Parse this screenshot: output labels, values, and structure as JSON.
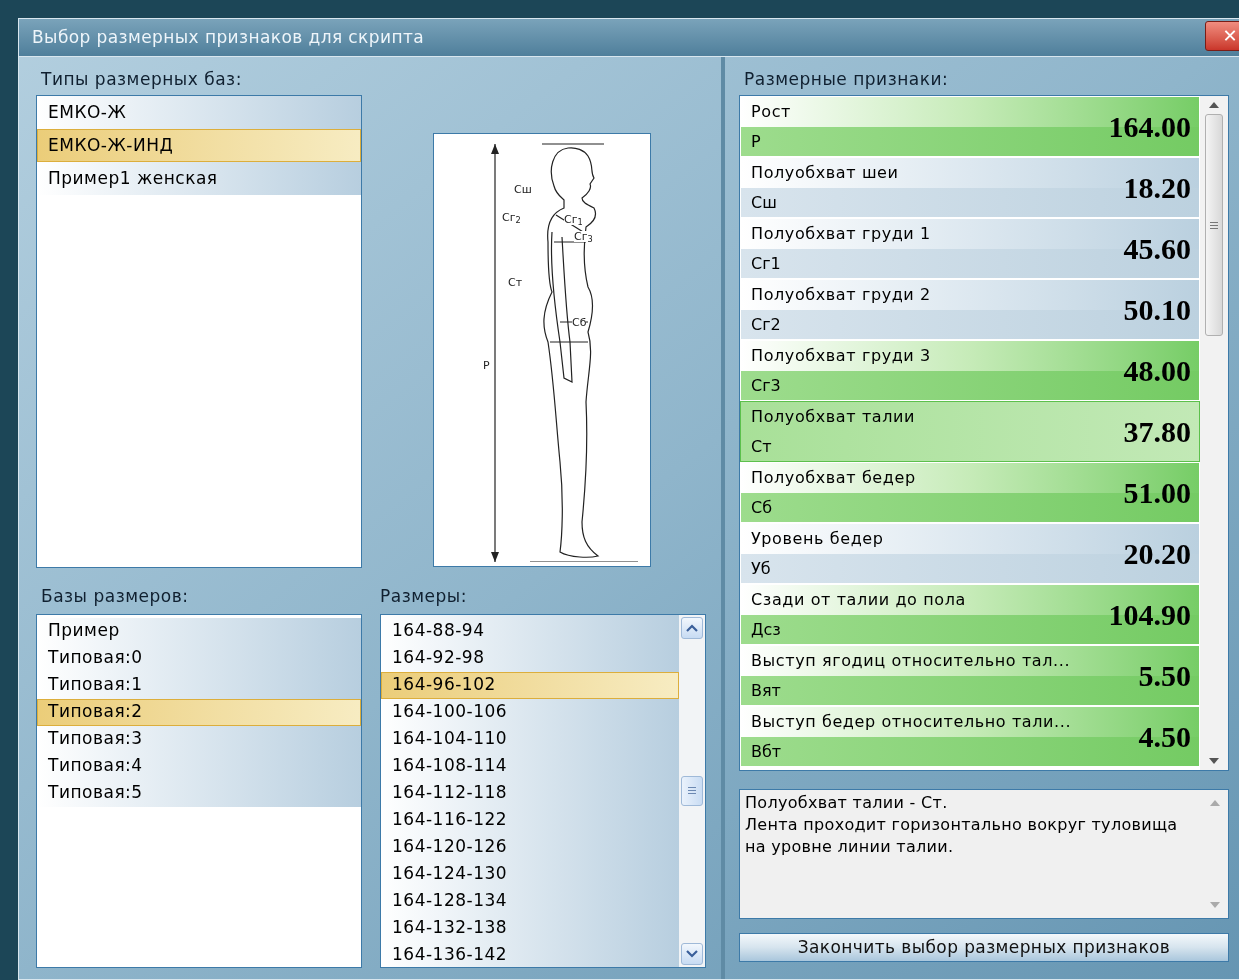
{
  "window": {
    "title": "Выбор размерных признаков для скрипта",
    "close": "✕"
  },
  "base_types": {
    "label": "Типы размерных баз:",
    "items": [
      {
        "text": "ЕМКО-Ж",
        "selected": false
      },
      {
        "text": "ЕМКО-Ж-ИНД",
        "selected": true
      },
      {
        "text": "Пример1 женская",
        "selected": false
      }
    ]
  },
  "figure": {
    "labels": [
      "Сш",
      "Сг$_{2}$",
      "Сг$_{1}$",
      "Сг$_{3}$",
      "Ст",
      "Сб",
      "Р"
    ]
  },
  "size_bases": {
    "label": "Базы размеров:",
    "items": [
      {
        "text": "Пример",
        "selected": false
      },
      {
        "text": "Типовая:0",
        "selected": false
      },
      {
        "text": "Типовая:1",
        "selected": false
      },
      {
        "text": "Типовая:2",
        "selected": true
      },
      {
        "text": "Типовая:3",
        "selected": false
      },
      {
        "text": "Типовая:4",
        "selected": false
      },
      {
        "text": "Типовая:5",
        "selected": false
      }
    ]
  },
  "sizes": {
    "label": "Размеры:",
    "items": [
      {
        "text": "164-88-94",
        "selected": false
      },
      {
        "text": "164-92-98",
        "selected": false
      },
      {
        "text": "164-96-102",
        "selected": true
      },
      {
        "text": "164-100-106",
        "selected": false
      },
      {
        "text": "164-104-110",
        "selected": false
      },
      {
        "text": "164-108-114",
        "selected": false
      },
      {
        "text": "164-112-118",
        "selected": false
      },
      {
        "text": "164-116-122",
        "selected": false
      },
      {
        "text": "164-120-126",
        "selected": false
      },
      {
        "text": "164-124-130",
        "selected": false
      },
      {
        "text": "164-128-134",
        "selected": false
      },
      {
        "text": "164-132-138",
        "selected": false
      },
      {
        "text": "164-136-142",
        "selected": false
      }
    ]
  },
  "measurements": {
    "label": "Размерные признаки:",
    "items": [
      {
        "name": "Рост",
        "code": "Р",
        "value": "164.00",
        "included": true,
        "selected": false
      },
      {
        "name": "Полуобхват шеи",
        "code": "Сш",
        "value": "18.20",
        "included": false,
        "selected": false
      },
      {
        "name": "Полуобхват груди 1",
        "code": "Сг1",
        "value": "45.60",
        "included": false,
        "selected": false
      },
      {
        "name": "Полуобхват груди 2",
        "code": "Сг2",
        "value": "50.10",
        "included": false,
        "selected": false
      },
      {
        "name": "Полуобхват груди 3",
        "code": "Сг3",
        "value": "48.00",
        "included": true,
        "selected": false
      },
      {
        "name": "Полуобхват талии",
        "code": "Ст",
        "value": "37.80",
        "included": true,
        "selected": true
      },
      {
        "name": "Полуобхват бедер",
        "code": "Сб",
        "value": "51.00",
        "included": true,
        "selected": false
      },
      {
        "name": "Уровень бедер",
        "code": "Уб",
        "value": "20.20",
        "included": false,
        "selected": false
      },
      {
        "name": "Сзади от талии до пола",
        "code": "Дсз",
        "value": "104.90",
        "included": true,
        "selected": false
      },
      {
        "name": "Выступ ягодиц относительно тал...",
        "code": "Вят",
        "value": "5.50",
        "included": true,
        "selected": false
      },
      {
        "name": "Выступ бедер относительно тали...",
        "code": "Вбт",
        "value": "4.50",
        "included": true,
        "selected": false
      }
    ]
  },
  "description": {
    "lines": [
      "Полуобхват талии - Ст.",
      "Лента проходит горизонтально вокруг туловища на уровне линии талии."
    ]
  },
  "finish_button": "Закончить выбор размерных признаков"
}
